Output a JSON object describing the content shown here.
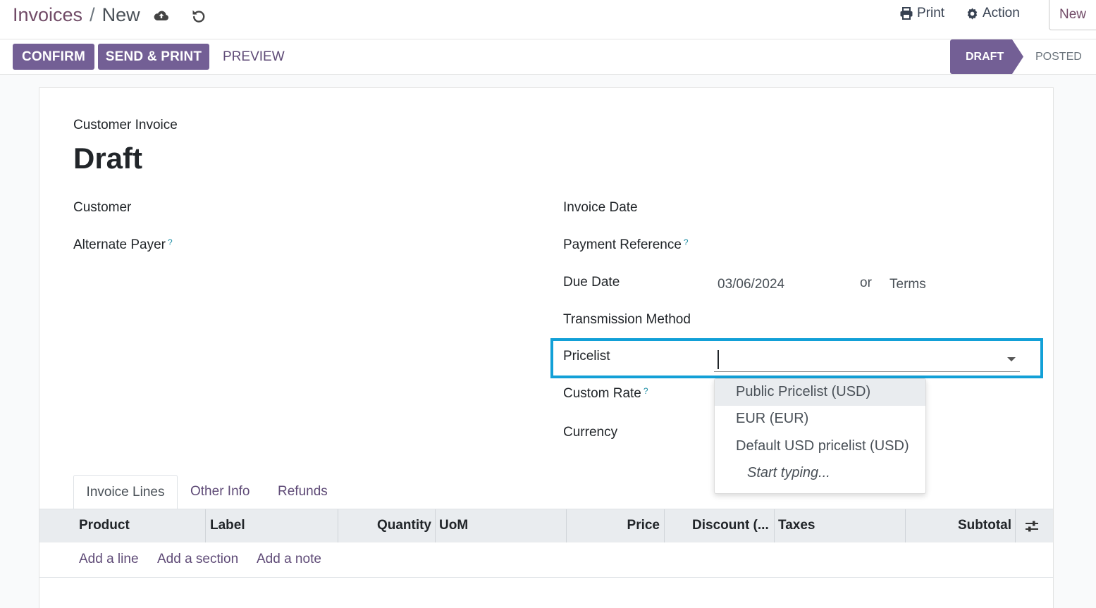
{
  "breadcrumb": {
    "parent": "Invoices",
    "separator": "/",
    "current": "New"
  },
  "top_actions": {
    "print_label": "Print",
    "action_label": "Action",
    "new_label": "New"
  },
  "statusbar": {
    "confirm_label": "CONFIRM",
    "send_print_label": "SEND & PRINT",
    "preview_label": "PREVIEW",
    "stages": {
      "draft": "DRAFT",
      "posted": "POSTED"
    }
  },
  "form": {
    "doc_type": "Customer Invoice",
    "title": "Draft",
    "left": {
      "customer_label": "Customer",
      "alternate_payer_label": "Alternate Payer"
    },
    "right": {
      "invoice_date_label": "Invoice Date",
      "payment_reference_label": "Payment Reference",
      "due_date_label": "Due Date",
      "due_date_value": "03/06/2024",
      "or_text": "or",
      "terms_placeholder": "Terms",
      "transmission_method_label": "Transmission Method",
      "pricelist_label": "Pricelist",
      "custom_rate_label": "Custom Rate",
      "currency_label": "Currency"
    },
    "help_mark": "?"
  },
  "pricelist_dropdown": {
    "options": [
      "Public Pricelist (USD)",
      "EUR (EUR)",
      "Default USD pricelist (USD)"
    ],
    "hint": "Start typing..."
  },
  "tabs": {
    "invoice_lines": "Invoice Lines",
    "other_info": "Other Info",
    "refunds": "Refunds"
  },
  "table": {
    "columns": [
      "Product",
      "Label",
      "Quantity",
      "UoM",
      "Price",
      "Discount (...",
      "Taxes",
      "Subtotal"
    ],
    "add_line": "Add a line",
    "add_section": "Add a section",
    "add_note": "Add a note"
  },
  "icons": {
    "save": "cloud-upload-icon",
    "discard": "undo-icon",
    "print": "printer-icon",
    "action": "gear-icon",
    "optional_columns": "sliders-icon"
  },
  "colors": {
    "primary": "#735f95",
    "link": "#5f4b77",
    "highlight": "#12a0d7"
  }
}
